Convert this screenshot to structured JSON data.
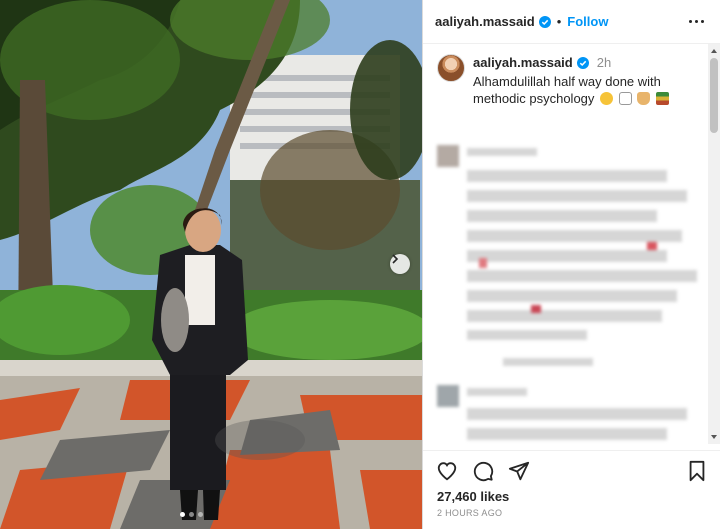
{
  "post": {
    "username": "aaliyah.massaid",
    "follow_label": "Follow",
    "separator": "•",
    "caption_time": "2h",
    "caption_text": "Alhamdulillah half way done with methodic psychology",
    "caption_emojis": [
      "hushed-face-emoji",
      "fist-bump-emoji",
      "folded-hands-emoji",
      "books-emoji"
    ],
    "likes": "27,460 likes",
    "posted_ago": "2 HOURS AGO"
  },
  "carousel": {
    "slide_count": 3,
    "active_index": 0
  },
  "icons": {
    "verified": "verified-badge-icon",
    "more": "more-options-icon",
    "next": "chevron-right-icon",
    "like": "heart-icon",
    "comment": "comment-bubble-icon",
    "share": "paper-plane-icon",
    "save": "bookmark-icon"
  },
  "colors": {
    "link_blue": "#0095f6",
    "verified_blue": "#0095f6",
    "text": "#262626",
    "muted": "#8e8e8e"
  }
}
